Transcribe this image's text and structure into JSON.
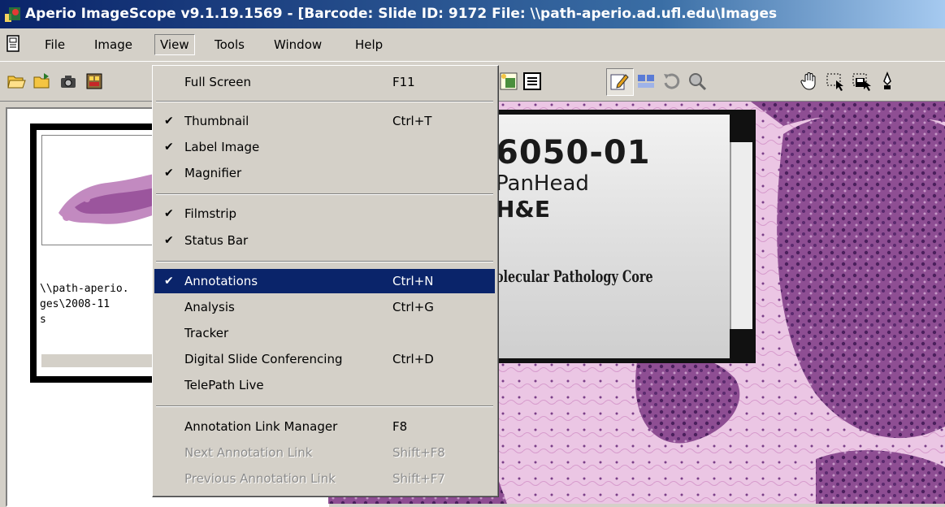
{
  "window": {
    "title": "Aperio ImageScope v9.1.19.1569 - [Barcode:  Slide ID: 9172  File: \\\\path-aperio.ad.ufl.edu\\Images"
  },
  "menubar": {
    "items": [
      {
        "label": "File"
      },
      {
        "label": "Image"
      },
      {
        "label": "View",
        "open": true
      },
      {
        "label": "Tools"
      },
      {
        "label": "Window"
      },
      {
        "label": "Help"
      }
    ]
  },
  "thumbnail": {
    "caption": "\\\\path-aperio.\nges\\2008-11\ns"
  },
  "slide_label": {
    "lines": [
      "6050-01",
      "PanHead",
      "H&E",
      "Molecular Pathology Core"
    ]
  },
  "view_menu": {
    "items": [
      {
        "label": "Full Screen",
        "shortcut": "F11",
        "checked": false
      },
      {
        "label": "Thumbnail",
        "shortcut": "Ctrl+T",
        "checked": true
      },
      {
        "label": "Label Image",
        "shortcut": "",
        "checked": true
      },
      {
        "label": "Magnifier",
        "shortcut": "",
        "checked": true
      },
      {
        "label": "Filmstrip",
        "shortcut": "",
        "checked": true
      },
      {
        "label": "Status Bar",
        "shortcut": "",
        "checked": true
      },
      {
        "label": "Annotations",
        "shortcut": "Ctrl+N",
        "checked": true,
        "selected": true
      },
      {
        "label": "Analysis",
        "shortcut": "Ctrl+G",
        "checked": false
      },
      {
        "label": "Tracker",
        "shortcut": "",
        "checked": false
      },
      {
        "label": "Digital Slide Conferencing",
        "shortcut": "Ctrl+D",
        "checked": false
      },
      {
        "label": "TelePath Live",
        "shortcut": "",
        "checked": false
      },
      {
        "label": "Annotation Link Manager",
        "shortcut": "F8",
        "checked": false
      },
      {
        "label": "Next Annotation Link",
        "shortcut": "Shift+F8",
        "checked": false,
        "disabled": true
      },
      {
        "label": "Previous Annotation Link",
        "shortcut": "Shift+F7",
        "checked": false,
        "disabled": true
      }
    ]
  },
  "colors": {
    "menu_highlight": "#0a246a",
    "title_gradient_start": "#0a246a",
    "window_face": "#d4d0c8"
  }
}
